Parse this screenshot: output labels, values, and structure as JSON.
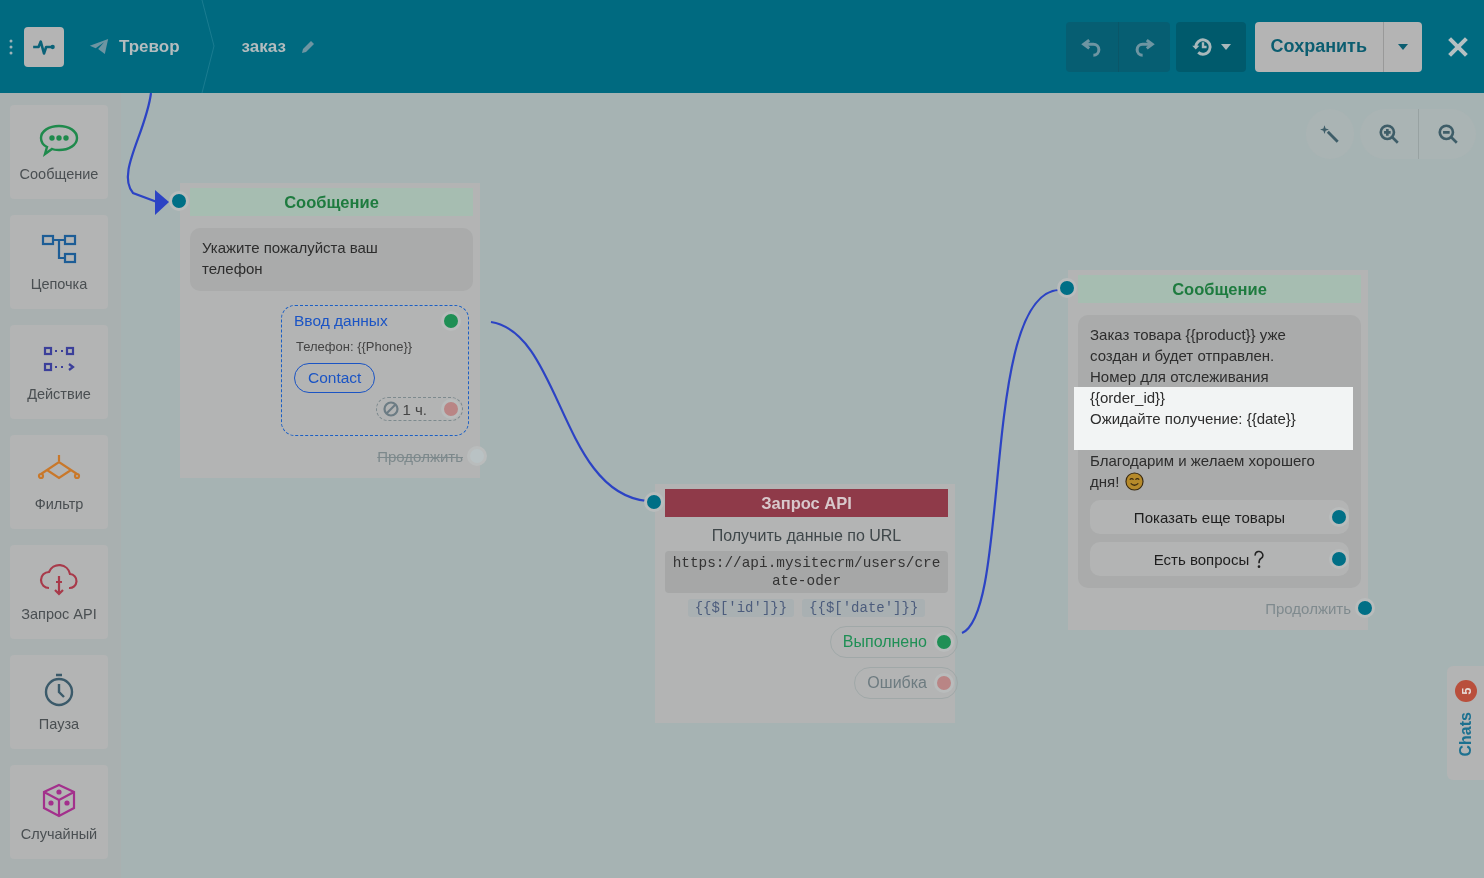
{
  "header": {
    "bot_name": "Тревор",
    "flow_name": "заказ",
    "save_label": "Сохранить"
  },
  "sidebar": {
    "items": [
      {
        "label": "Сообщение",
        "kind": "message",
        "color": "#1f8a4c"
      },
      {
        "label": "Цепочка",
        "kind": "chain",
        "color": "#1d5d96"
      },
      {
        "label": "Действие",
        "kind": "action",
        "color": "#3b3f9a"
      },
      {
        "label": "Фильтр",
        "kind": "filter",
        "color": "#c9782a"
      },
      {
        "label": "Запрос API",
        "kind": "api",
        "color": "#a83a4a"
      },
      {
        "label": "Пауза",
        "kind": "pause",
        "color": "#3b5a6a"
      },
      {
        "label": "Случайный",
        "kind": "random",
        "color": "#a3308c"
      }
    ]
  },
  "nodes": [
    {
      "kind": "message",
      "title": "Сообщение",
      "text": "Укажите пожалуйста ваш телефон",
      "input": {
        "title": "Ввод данных",
        "field": "Телефон: {{Phone}}",
        "button": "Contact",
        "timeout": "1 ч."
      },
      "continue": {
        "label": "Продолжить",
        "disabled": true
      }
    },
    {
      "kind": "api",
      "title": "Запрос API",
      "subtitle": "Получить данные по URL",
      "url": "https://api.mysitecrm/users/create-oder",
      "params": [
        "{{$['id']}}",
        "{{$['date']}}"
      ],
      "outputs": [
        {
          "label": "Выполнено",
          "color": "#1f8f55"
        },
        {
          "label": "Ошибка",
          "color": "#b98585"
        }
      ]
    },
    {
      "kind": "message",
      "title": "Сообщение",
      "paragraphs": [
        {
          "lines": [
            "Заказ товара {{product}} уже",
            "создан и будет отправлен.",
            "Номер для отслеживания"
          ],
          "highlighted": false,
          "smiley": false
        },
        {
          "lines": [
            "{{order_id}}",
            "Ожидайте получение: {{date}}"
          ],
          "highlighted": true,
          "smiley": false
        },
        {
          "lines": [
            "Благодарим и желаем хорошего",
            "дня!"
          ],
          "highlighted": false,
          "smiley": true
        }
      ],
      "buttons": [
        {
          "label": "Показать еще товары",
          "question_icon": false
        },
        {
          "label": "Есть вопросы",
          "question_icon": true
        }
      ],
      "continue": {
        "label": "Продолжить",
        "disabled": false
      }
    }
  ],
  "chats": {
    "label": "Chats",
    "count": "5"
  }
}
